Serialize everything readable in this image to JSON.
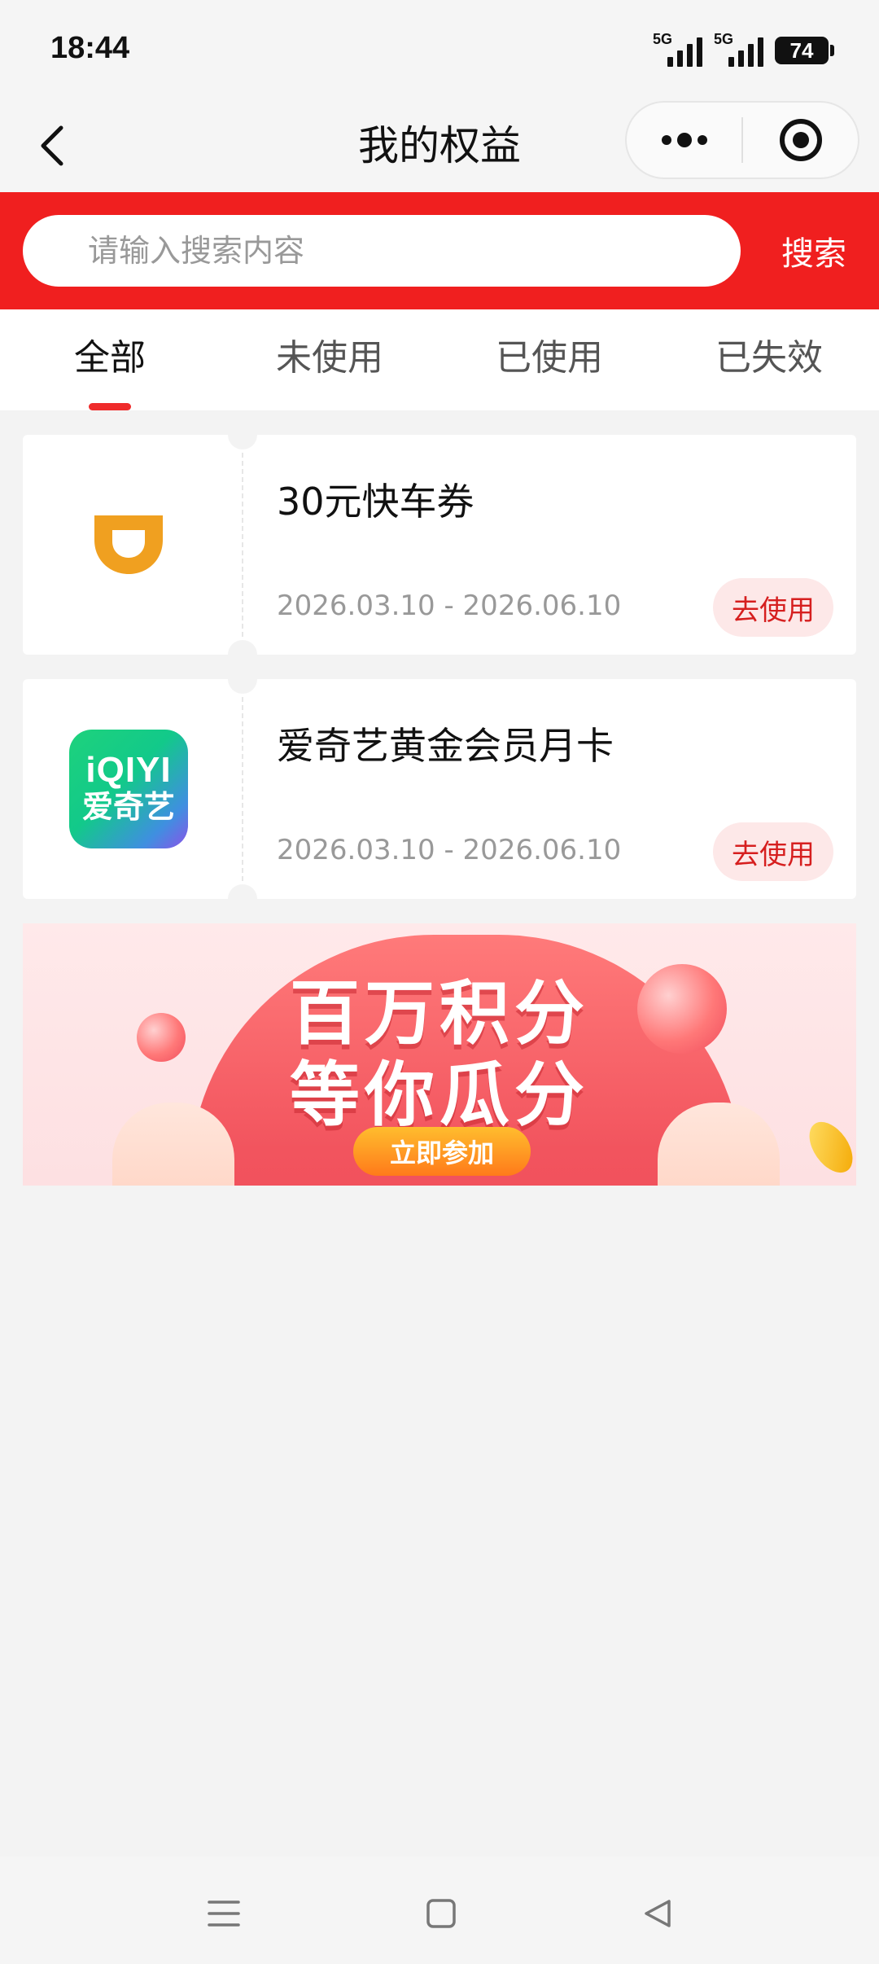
{
  "status_bar": {
    "time": "18:44",
    "signal1_label": "5G",
    "signal2_label": "5G",
    "battery": "74"
  },
  "nav": {
    "title": "我的权益"
  },
  "search": {
    "placeholder": "请输入搜索内容",
    "button_label": "搜索"
  },
  "tabs": [
    {
      "label": "全部",
      "active": true
    },
    {
      "label": "未使用",
      "active": false
    },
    {
      "label": "已使用",
      "active": false
    },
    {
      "label": "已失效",
      "active": false
    }
  ],
  "coupons": [
    {
      "name": "30元快车券",
      "date_range": "2026.03.10 - 2026.06.10",
      "action_label": "去使用",
      "logo": "didi-logo"
    },
    {
      "name": "爱奇艺黄金会员月卡",
      "date_range": "2026.03.10 - 2026.06.10",
      "action_label": "去使用",
      "logo": "iqiyi-logo",
      "logo_text_line1": "iQIYI",
      "logo_text_line2": "爱奇艺"
    }
  ],
  "banner": {
    "line1": "百万积分",
    "line2": "等你瓜分",
    "button_label": "立即参加"
  },
  "colors": {
    "brand_red": "#f01f1f",
    "tab_indicator": "#ef2b2b",
    "use_button_text": "#d61f1f",
    "use_button_bg": "#fde8e8",
    "didi_orange": "#f0a020"
  }
}
